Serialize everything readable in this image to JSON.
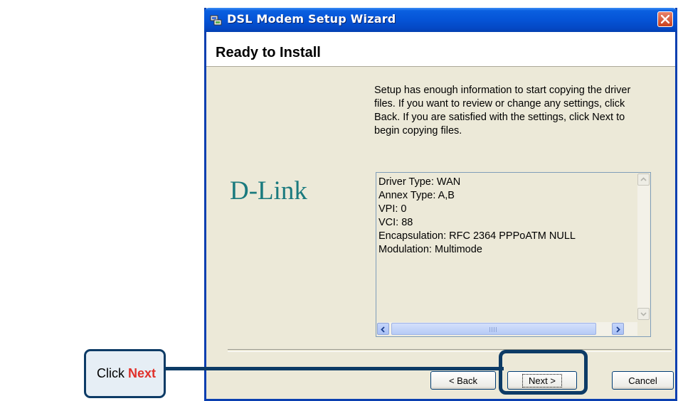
{
  "window": {
    "title": "DSL Modem Setup Wizard"
  },
  "header": {
    "title": "Ready to Install"
  },
  "logo": "D-Link",
  "intro_text": "Setup has enough information to start copying the driver files.  If you want to review or change any settings, click Back.  If you are satisfied with the settings, click Next to begin copying files.",
  "summary": {
    "lines": [
      "Driver Type: WAN",
      "Annex Type: A,B",
      "VPI: 0",
      "VCI: 88",
      "Encapsulation: RFC 2364 PPPoATM NULL",
      "Modulation: Multimode"
    ],
    "scrollbar_grip": "IIII"
  },
  "buttons": {
    "back": "< Back",
    "next": "Next >",
    "cancel": "Cancel"
  },
  "callout": {
    "prefix": "Click ",
    "highlight": "Next",
    "highlight_color": "#e0302a",
    "border_color": "#0d3b66"
  }
}
